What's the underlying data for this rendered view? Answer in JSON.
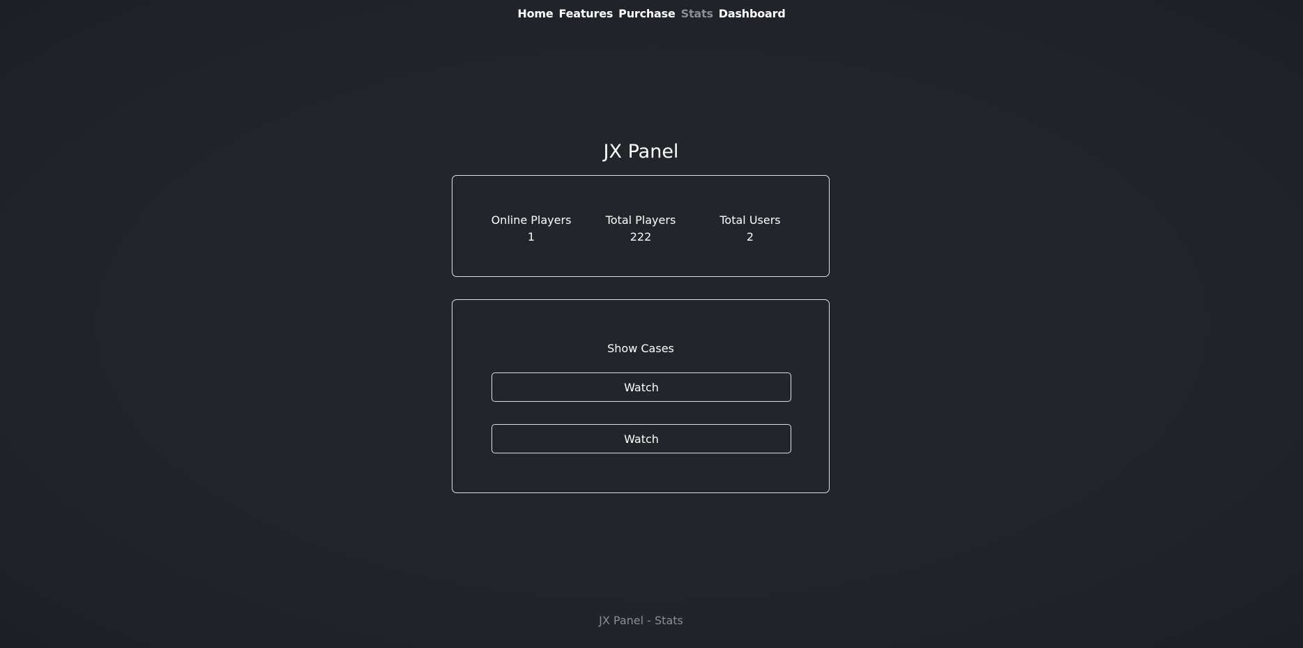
{
  "nav": {
    "items": [
      {
        "label": "Home",
        "active": false
      },
      {
        "label": "Features",
        "active": false
      },
      {
        "label": "Purchase",
        "active": false
      },
      {
        "label": "Stats",
        "active": true
      },
      {
        "label": "Dashboard",
        "active": false
      }
    ]
  },
  "page": {
    "title": "JX Panel"
  },
  "stats": [
    {
      "label": "Online Players",
      "value": "1"
    },
    {
      "label": "Total Players",
      "value": "222"
    },
    {
      "label": "Total Users",
      "value": "2"
    }
  ],
  "showcase": {
    "label": "Show Cases",
    "buttons": [
      "Watch",
      "Watch"
    ]
  },
  "footer": {
    "text": "JX Panel - Stats"
  },
  "colors": {
    "background": "#212529",
    "border": "#dee2e6",
    "muted": "#8a8f94"
  }
}
